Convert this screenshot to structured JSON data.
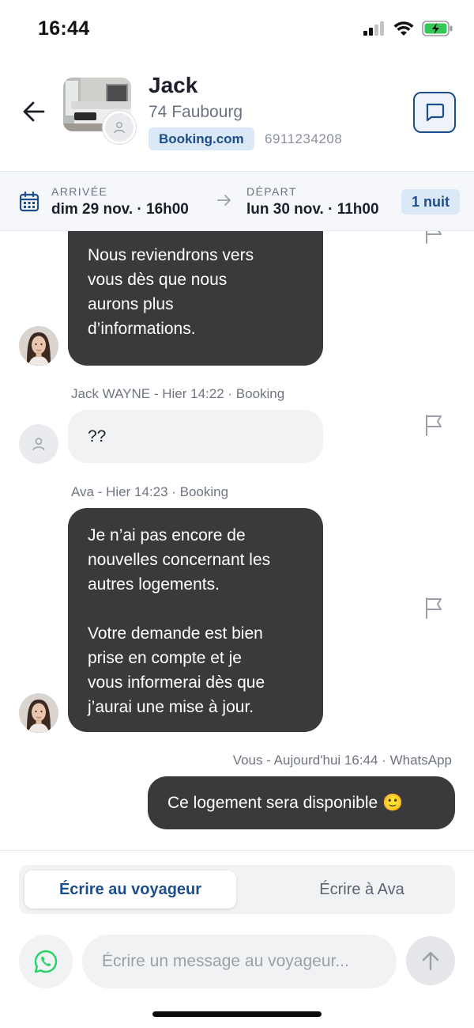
{
  "status_bar": {
    "time": "16:44",
    "icons": [
      "cellular-signal-icon",
      "wifi-icon",
      "battery-charging-icon"
    ]
  },
  "header": {
    "back_icon": "arrow-left-icon",
    "guest_name": "Jack",
    "property_name": "74 Faubourg",
    "channel": "Booking.com",
    "reservation_number": "6911234208",
    "message_icon": "chat-bubble-icon"
  },
  "stay": {
    "arrival_label": "ARRIVÉE",
    "arrival_value": "dim 29 nov. · 16h00",
    "departure_label": "DÉPART",
    "departure_value": "lun 30 nov. · 11h00",
    "nights": "1 nuit"
  },
  "messages": [
    {
      "sender": "ava",
      "lines": [
        "Nous reviendrons vers",
        "vous dès que nous",
        "aurons plus",
        "d’informations."
      ]
    },
    {
      "meta": "Jack WAYNE - Hier 14:22 · Booking",
      "sender": "guest",
      "lines": [
        "??"
      ]
    },
    {
      "meta": "Ava - Hier 14:23 · Booking",
      "sender": "ava",
      "lines": [
        "Je n’ai pas encore de",
        "nouvelles concernant les",
        "autres logements.",
        "",
        "Votre demande est bien",
        "prise en compte et je",
        "vous informerai dès que",
        "j’aurai une mise à jour."
      ]
    },
    {
      "meta": "Vous - Aujourd'hui 16:44 · WhatsApp",
      "sender": "you",
      "lines": [
        "Ce logement sera disponible 🙂"
      ]
    }
  ],
  "composer": {
    "tab_guest": "Écrire au voyageur",
    "tab_ava": "Écrire à Ava",
    "active_tab": "Écrire au voyageur",
    "input_placeholder": "Écrire un message au voyageur...",
    "input_value": "",
    "channel_icon": "whatsapp-icon",
    "send_icon": "arrow-up-icon"
  },
  "colors": {
    "accent": "#1d4e89",
    "badge_bg": "#dbe8f7",
    "dark_bubble": "#3a3a3c",
    "light_bubble": "#f1f2f4",
    "battery_green": "#34c759"
  }
}
